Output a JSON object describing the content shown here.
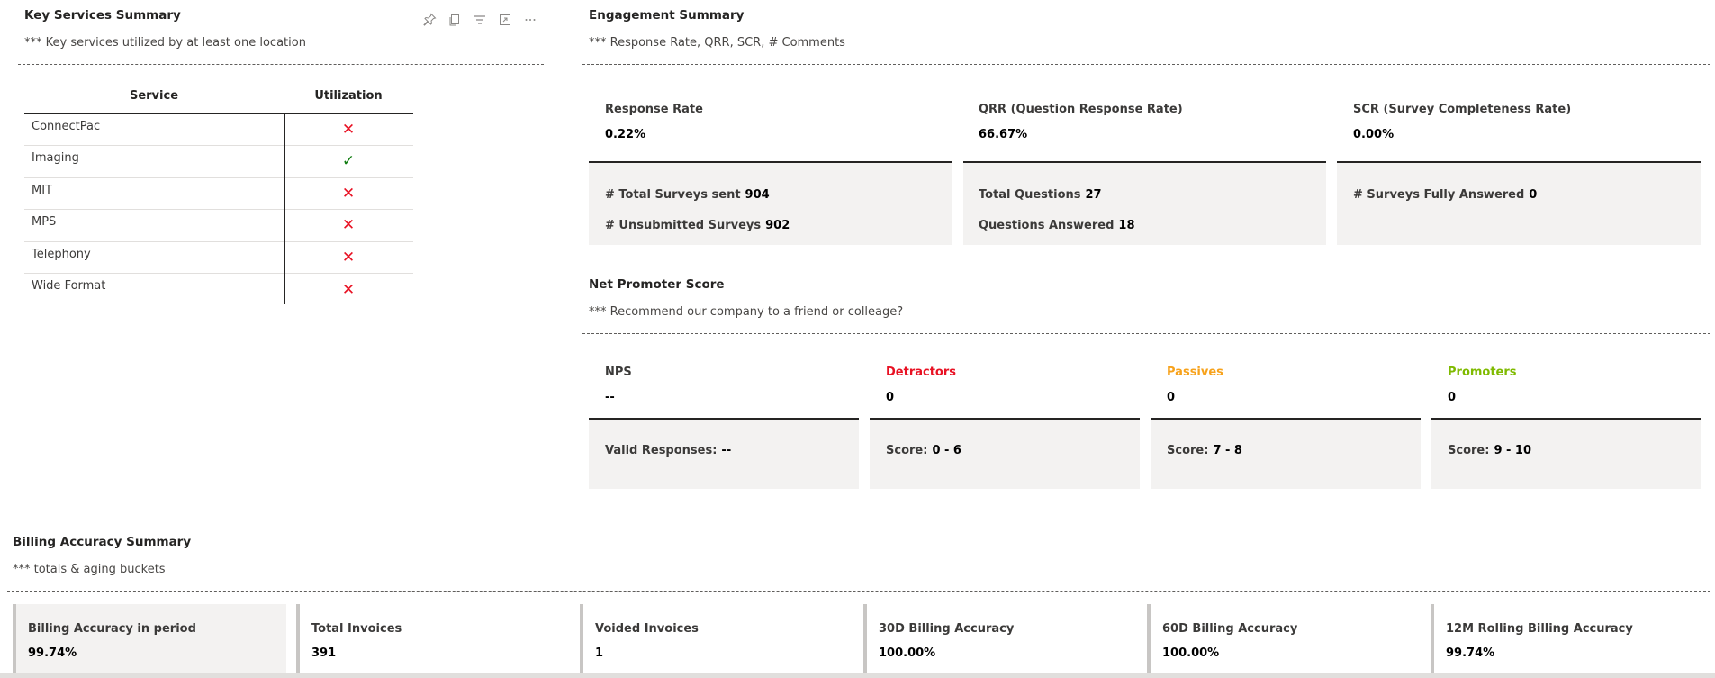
{
  "key_services": {
    "title": "Key Services Summary",
    "subtitle": "*** Key services utilized by at least one location",
    "headers": {
      "service": "Service",
      "utilization": "Utilization"
    },
    "rows": [
      {
        "service": "ConnectPac",
        "utilized": false,
        "mark": "✕"
      },
      {
        "service": "Imaging",
        "utilized": true,
        "mark": "✓"
      },
      {
        "service": "MIT",
        "utilized": false,
        "mark": "✕"
      },
      {
        "service": "MPS",
        "utilized": false,
        "mark": "✕"
      },
      {
        "service": "Telephony",
        "utilized": false,
        "mark": "✕"
      },
      {
        "service": "Wide Format",
        "utilized": false,
        "mark": "✕"
      }
    ],
    "toolbar_icons": [
      "pin-icon",
      "copy-icon",
      "filter-icon",
      "focus-mode-icon",
      "more-options-icon"
    ]
  },
  "engagement": {
    "title": "Engagement Summary",
    "subtitle": "*** Response Rate, QRR, SCR, # Comments",
    "cards": [
      {
        "label": "Response Rate",
        "value": "0.22%",
        "details": [
          {
            "key": "# Total Surveys sent",
            "value": "904"
          },
          {
            "key": "# Unsubmitted Surveys",
            "value": "902"
          }
        ]
      },
      {
        "label": "QRR (Question Response Rate)",
        "value": "66.67%",
        "details": [
          {
            "key": "Total Questions",
            "value": "27"
          },
          {
            "key": "Questions Answered",
            "value": "18"
          }
        ]
      },
      {
        "label": "SCR (Survey Completeness Rate)",
        "value": "0.00%",
        "details": [
          {
            "key": "# Surveys Fully Answered",
            "value": "0"
          }
        ]
      }
    ]
  },
  "nps": {
    "title": "Net Promoter Score",
    "subtitle": "*** Recommend our company to a friend or colleage?",
    "cards": [
      {
        "label": "NPS",
        "value": "--",
        "detail_key": "Valid Responses:",
        "detail_value": "--",
        "color": "#3b3a39"
      },
      {
        "label": "Detractors",
        "value": "0",
        "detail_key": "Score:",
        "detail_value": "0 - 6",
        "color": "#e81123"
      },
      {
        "label": "Passives",
        "value": "0",
        "detail_key": "Score:",
        "detail_value": "7 - 8",
        "color": "#f7a21b"
      },
      {
        "label": "Promoters",
        "value": "0",
        "detail_key": "Score:",
        "detail_value": "9 - 10",
        "color": "#7fba00"
      }
    ]
  },
  "billing": {
    "title": "Billing Accuracy Summary",
    "subtitle": "*** totals & aging buckets",
    "cards": [
      {
        "label": "Billing Accuracy in period",
        "value": "99.74%"
      },
      {
        "label": "Total Invoices",
        "value": "391"
      },
      {
        "label": "Voided Invoices",
        "value": "1"
      },
      {
        "label": "30D Billing Accuracy",
        "value": "100.00%"
      },
      {
        "label": "60D Billing Accuracy",
        "value": "100.00%"
      },
      {
        "label": "12M Rolling Billing Accuracy",
        "value": "99.74%"
      }
    ]
  }
}
